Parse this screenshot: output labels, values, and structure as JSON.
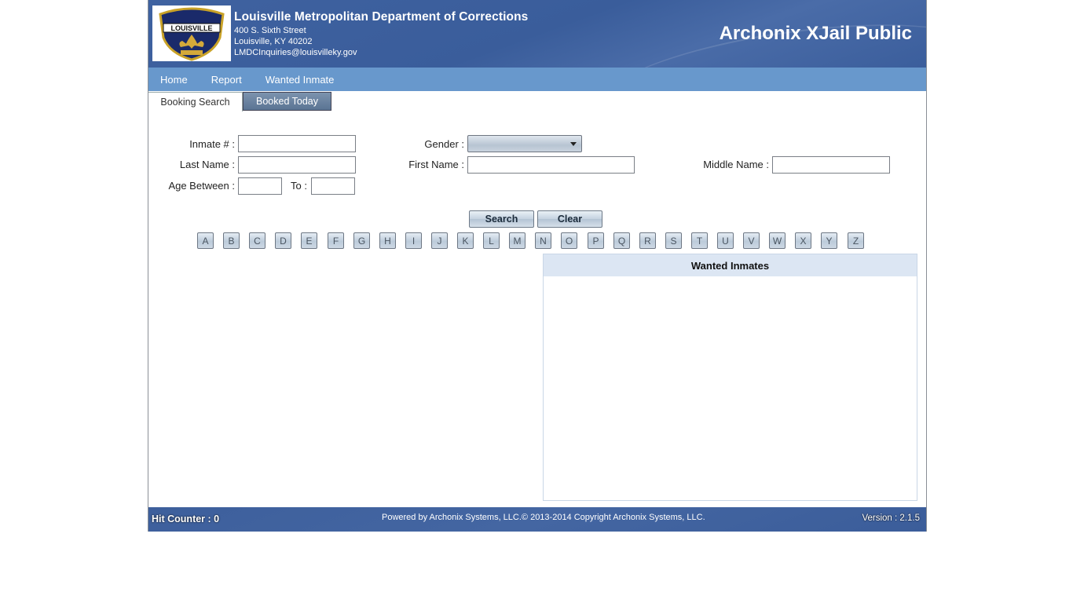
{
  "header": {
    "org_name": "Louisville Metropolitan Department of Corrections",
    "address_line1": "400 S. Sixth Street",
    "address_line2": "Louisville, KY 40202",
    "email": "LMDCInquiries@louisvilleky.gov",
    "app_title": "Archonix XJail Public",
    "logo_icon": "corrections-badge-logo",
    "logo_text": "LOUISVILLE"
  },
  "nav": {
    "items": [
      {
        "label": "Home"
      },
      {
        "label": "Report"
      },
      {
        "label": "Wanted Inmate"
      }
    ]
  },
  "tabs": [
    {
      "label": "Booking Search",
      "active": true
    },
    {
      "label": "Booked Today",
      "active": false
    }
  ],
  "form": {
    "inmate_number": {
      "label": "Inmate # :",
      "value": ""
    },
    "gender": {
      "label": "Gender :",
      "selected": ""
    },
    "last_name": {
      "label": "Last Name :",
      "value": ""
    },
    "first_name": {
      "label": "First Name :",
      "value": ""
    },
    "middle_name": {
      "label": "Middle Name :",
      "value": ""
    },
    "age_between": {
      "label": "Age Between :",
      "value": ""
    },
    "age_to": {
      "label": "To :",
      "value": ""
    },
    "search_label": "Search",
    "clear_label": "Clear"
  },
  "letters": [
    "A",
    "B",
    "C",
    "D",
    "E",
    "F",
    "G",
    "H",
    "I",
    "J",
    "K",
    "L",
    "M",
    "N",
    "O",
    "P",
    "Q",
    "R",
    "S",
    "T",
    "U",
    "V",
    "W",
    "X",
    "Y",
    "Z"
  ],
  "wanted_panel": {
    "title": "Wanted Inmates"
  },
  "footer": {
    "hit_counter": "Hit Counter : 0",
    "powered_by": "Powered by Archonix Systems, LLC.© 2013-2014 Copyright Archonix Systems, LLC.",
    "version": "Version : 2.1.5"
  },
  "colors": {
    "header_bg": "#3f62a0",
    "nav_bg": "#6898cc",
    "panel_header_bg": "#dce6f3"
  }
}
